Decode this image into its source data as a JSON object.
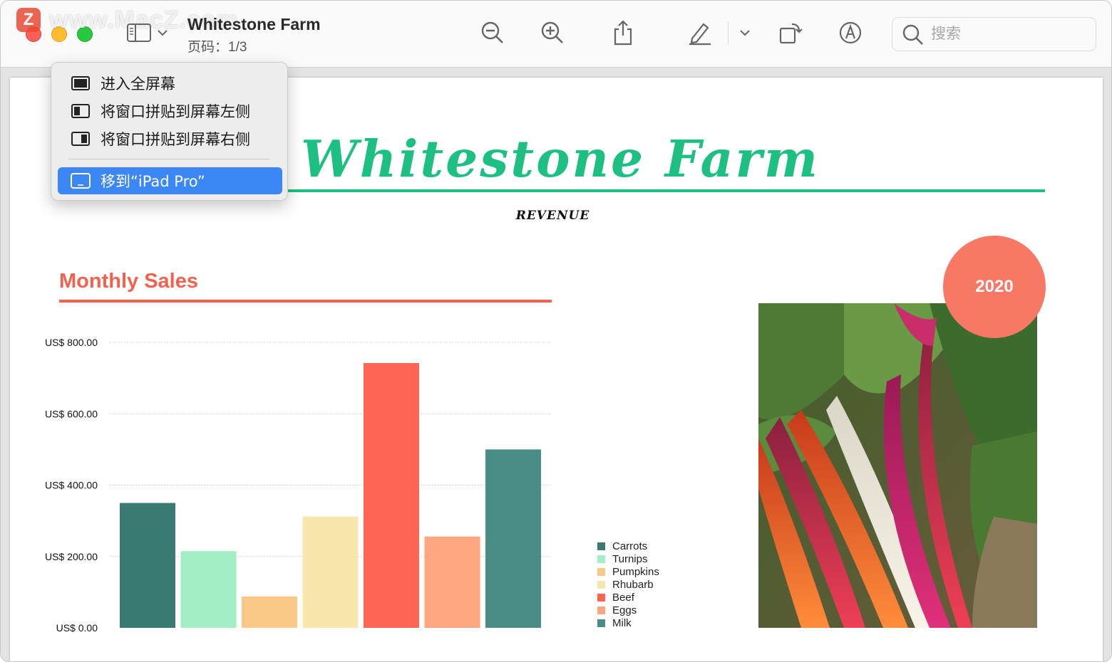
{
  "window": {
    "title": "Whitestone Farm",
    "subtitle": "页码：1/3",
    "watermark": "www.MacZ.com",
    "watermark_badge": "Z"
  },
  "toolbar": {
    "icons": [
      "sidebar-icon",
      "chevron-down-icon",
      "zoom-out-icon",
      "zoom-in-icon",
      "share-icon",
      "highlight-pen-icon",
      "chevron-down-icon",
      "rotate-icon",
      "markup-icon",
      "search-icon"
    ],
    "search_placeholder": "搜索"
  },
  "menu": {
    "items": [
      {
        "label": "进入全屏幕",
        "icon": "fullscreen-icon"
      },
      {
        "label": "将窗口拼贴到屏幕左侧",
        "icon": "tile-left-icon"
      },
      {
        "label": "将窗口拼贴到屏幕右侧",
        "icon": "tile-right-icon"
      },
      {
        "label": "移到“iPad Pro”",
        "icon": "ipad-icon",
        "selected": true
      }
    ]
  },
  "document": {
    "title": "Whitestone Farm",
    "subtitle": "REVENUE",
    "section_title": "Monthly Sales",
    "year_badge": "2020"
  },
  "colors": {
    "accent_green": "#1dbf82",
    "accent_coral": "#f4624f",
    "menu_highlight": "#3b87f5"
  },
  "chart_data": {
    "type": "bar",
    "categories": [
      "Carrots",
      "Turnips",
      "Pumpkins",
      "Rhubarb",
      "Beef",
      "Eggs",
      "Milk"
    ],
    "values": [
      350,
      215,
      88,
      312,
      742,
      256,
      500
    ],
    "colors": [
      "#3a7a72",
      "#a2efc6",
      "#fbc987",
      "#f9e6ae",
      "#fe6454",
      "#fea67f",
      "#4a8c86"
    ],
    "y_ticks": [
      "US$ 0.00",
      "US$ 200.00",
      "US$ 400.00",
      "US$ 600.00",
      "US$ 800.00"
    ],
    "ylim": [
      0,
      800
    ],
    "grid": true,
    "legend_position": "right",
    "xlabel": "",
    "ylabel": ""
  }
}
